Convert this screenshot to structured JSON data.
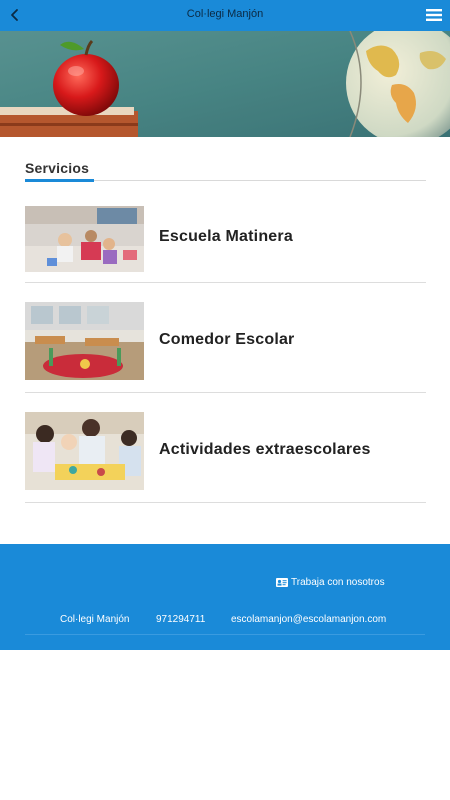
{
  "header": {
    "title": "Col·legi Manjón",
    "back_icon": "chevron-left-icon",
    "menu_icon": "hamburger-menu-icon"
  },
  "section": {
    "title": "Servicios"
  },
  "items": [
    {
      "label": "Escuela Matinera"
    },
    {
      "label": "Comedor Escolar"
    },
    {
      "label": "Actividades extraescolares"
    }
  ],
  "footer": {
    "work_label": "Trabaja con nosotros",
    "work_icon": "id-card-icon",
    "school_name": "Col·legi Manjón",
    "phone": "971294711",
    "email": "escolamanjon@escolamanjon.com"
  },
  "colors": {
    "primary": "#1a8ad8",
    "text_dark": "#222222"
  }
}
